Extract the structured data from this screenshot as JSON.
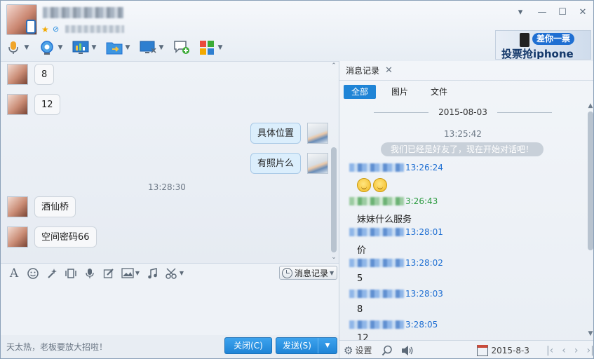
{
  "header": {
    "window_controls": [
      "▾",
      "—",
      "☐",
      "✕"
    ]
  },
  "toolbar": {
    "icons": [
      "microphone-icon",
      "video-camera-icon",
      "screen-share-icon",
      "file-transfer-icon",
      "remote-desktop-icon",
      "create-discussion-icon",
      "app-grid-icon"
    ]
  },
  "ad": {
    "tag": "差你一票",
    "text": "投票抢iphone"
  },
  "chat": {
    "messages": [
      {
        "side": "left",
        "text": "8"
      },
      {
        "side": "left",
        "text": "12"
      },
      {
        "side": "right",
        "text": "具体位置"
      },
      {
        "side": "right",
        "text": "有照片么"
      },
      {
        "side": "time",
        "text": "13:28:30"
      },
      {
        "side": "left",
        "text": "酒仙桥"
      },
      {
        "side": "left",
        "text": "空间密码66"
      }
    ]
  },
  "input_toolbar": {
    "font_icon": "A",
    "history_label": "消息记录"
  },
  "footer": {
    "hint": "天太热，老板要放大招啦！",
    "close_label": "关闭(C)",
    "send_label": "发送(S)"
  },
  "history": {
    "tab_label": "消息记录",
    "filters": [
      "全部",
      "图片",
      "文件"
    ],
    "date": "2015-08-03",
    "first_time": "13:25:42",
    "system_message": "我们已经是好友了，现在开始对话吧！",
    "entries": [
      {
        "time": "13:26:24",
        "sender": "blue",
        "body": "emoji"
      },
      {
        "time": "3:26:43",
        "sender": "green",
        "body": "妹妹什么服务"
      },
      {
        "time": "13:28:01",
        "sender": "blue",
        "body": "价"
      },
      {
        "time": "13:28:02",
        "sender": "blue",
        "body": "5"
      },
      {
        "time": "13:28:03",
        "sender": "blue",
        "body": "8"
      },
      {
        "time": "3:28:05",
        "sender": "blue",
        "body": "12"
      }
    ],
    "settings_label": "设置",
    "footer_date": "2015-8-3"
  },
  "colors": {
    "accent": "#1f84d6",
    "bubble_sent": "#dbeefc",
    "time_blue": "#1f6fd2",
    "time_green": "#2a9a3e"
  }
}
